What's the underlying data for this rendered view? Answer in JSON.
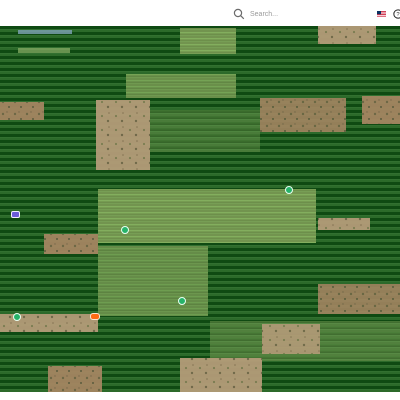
{
  "header": {
    "search_placeholder": "Search...",
    "search_icon": "search-icon",
    "flag_icon": "us-flag-icon",
    "help_icon": "help-icon"
  },
  "map": {
    "background_color": "#1e5a1d",
    "panel_row_color": "#0f4a12",
    "markers": [
      {
        "name": "marker-green-top",
        "type": "green"
      },
      {
        "name": "marker-purple-left",
        "type": "purple"
      },
      {
        "name": "marker-green-mid",
        "type": "green"
      },
      {
        "name": "marker-green-lower",
        "type": "green"
      },
      {
        "name": "marker-green-bottom-left",
        "type": "green"
      },
      {
        "name": "marker-orange-bottom-left",
        "type": "orange"
      }
    ]
  }
}
